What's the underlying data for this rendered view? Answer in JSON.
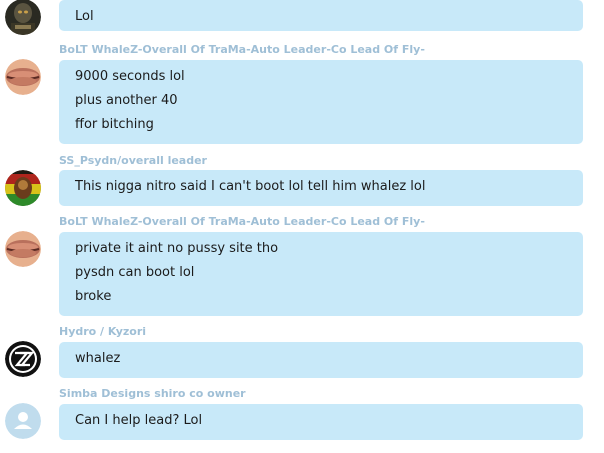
{
  "messages": [
    {
      "sender": "",
      "avatar": "dark-game-avatar",
      "lines": [
        "Lol"
      ]
    },
    {
      "sender": "BoLT WhaleZ-Overall Of TraMa-Auto Leader-Co Lead Of Fly-",
      "avatar": "lips-avatar",
      "lines": [
        "9000 seconds lol",
        "plus another 40",
        "ffor bitching"
      ]
    },
    {
      "sender": "SS_Psydn/overall leader",
      "avatar": "rasta-lion-avatar",
      "lines": [
        "This nigga nitro said I can't boot lol tell him whalez lol"
      ]
    },
    {
      "sender": "BoLT WhaleZ-Overall Of TraMa-Auto Leader-Co Lead Of Fly-",
      "avatar": "lips-avatar",
      "lines": [
        "private it aint no pussy site tho",
        "pysdn can boot lol",
        "broke"
      ]
    },
    {
      "sender": "Hydro / Kyzori",
      "avatar": "zz-logo-avatar",
      "lines": [
        "whalez"
      ]
    },
    {
      "sender": "Simba Designs shiro co owner",
      "avatar": "default-user-avatar",
      "lines": [
        "Can I help lead? Lol"
      ]
    }
  ],
  "colors": {
    "bubble": "#c8e9f9",
    "sender_name": "#9fbfd6",
    "message_text": "#1b1b1b",
    "default_avatar": "#c0dced"
  }
}
